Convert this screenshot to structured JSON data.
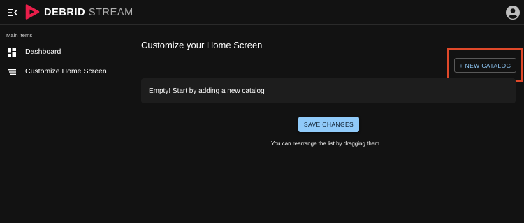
{
  "app": {
    "brand_strong": "DEBRID",
    "brand_light": "STREAM",
    "accent_color": "#e91e4a",
    "logo_icon": "play-logo-icon",
    "menu_icon": "menu-collapse-icon",
    "account_icon": "account-circle-icon"
  },
  "sidebar": {
    "section_title": "Main items",
    "items": [
      {
        "label": "Dashboard",
        "icon": "dashboard-icon"
      },
      {
        "label": "Customize Home Screen",
        "icon": "sort-list-icon"
      }
    ]
  },
  "main": {
    "title": "Customize your Home Screen",
    "new_catalog_label": "+ NEW CATALOG",
    "empty_text": "Empty! Start by adding a new catalog",
    "save_label": "SAVE CHANGES",
    "hint": "You can rearrange the list by dragging them",
    "button_color": "#90caf9",
    "highlight_color": "#e0492a"
  }
}
